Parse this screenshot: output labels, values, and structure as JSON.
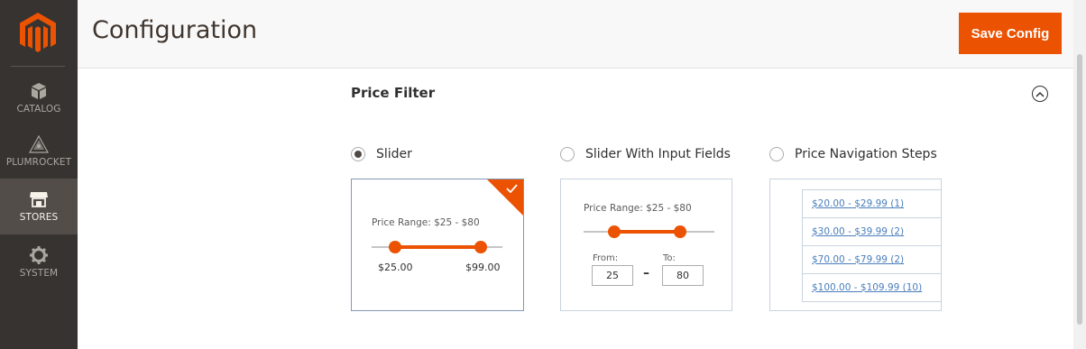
{
  "sidebar": {
    "items": [
      {
        "label": "CATALOG",
        "icon": "cube-icon"
      },
      {
        "label": "PLUMROCKET",
        "icon": "plumrocket-icon"
      },
      {
        "label": "STORES",
        "icon": "store-icon",
        "active": true
      },
      {
        "label": "SYSTEM",
        "icon": "gear-icon"
      }
    ]
  },
  "header": {
    "title": "Configuration",
    "save_label": "Save Config"
  },
  "section": {
    "title": "Price Filter",
    "options": [
      {
        "label": "Slider",
        "checked": true
      },
      {
        "label": "Slider With Input Fields",
        "checked": false
      },
      {
        "label": "Price Navigation Steps",
        "checked": false
      }
    ]
  },
  "preview_slider": {
    "range_label": "Price Range: $25 - $80",
    "min_value": "$25.00",
    "max_value": "$99.00"
  },
  "preview_inputs": {
    "range_label": "Price Range: $25 - $80",
    "from_label": "From:",
    "to_label": "To:",
    "from_value": "25",
    "to_value": "80",
    "dash": "–"
  },
  "preview_steps": {
    "steps": [
      "$20.00 - $29.99 (1)",
      "$30.00 - $39.99 (2)",
      "$70.00 - $79.99 (2)",
      "$100.00 - $109.99 (10)"
    ]
  },
  "colors": {
    "accent": "#eb5202",
    "sidebar_bg": "#373330",
    "link": "#4a7ebb"
  }
}
